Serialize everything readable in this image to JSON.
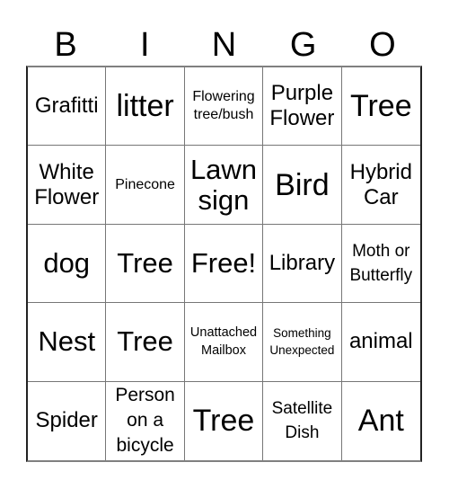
{
  "header": [
    "B",
    "I",
    "N",
    "G",
    "O"
  ],
  "cells": [
    "Grafitti",
    "litter",
    "Flowering tree/bush",
    "Purple Flower",
    "Tree",
    "White Flower",
    "Pinecone",
    "Lawn sign",
    "Bird",
    "Hybrid Car",
    "dog",
    "Tree",
    "Free!",
    "Library",
    "Moth or Butterfly",
    "Nest",
    "Tree",
    "Unattached Mailbox",
    "Something Unexpected",
    "animal",
    "Spider",
    "Person on a bicycle",
    "Tree",
    "Satellite Dish",
    "Ant"
  ]
}
